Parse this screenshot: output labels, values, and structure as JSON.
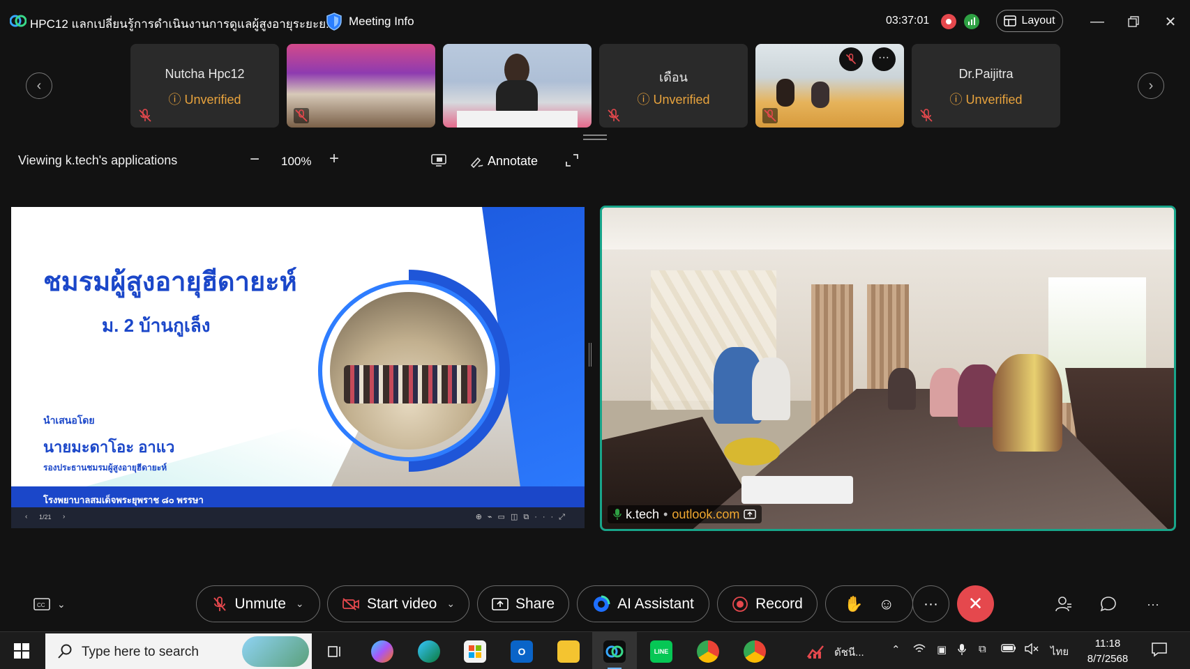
{
  "window": {
    "title": "HPC12 แลกเปลี่ยนรู้การดำเนินงานการดูแลผู้สูงอายุระยะย...",
    "meeting_info_label": "Meeting Info",
    "timer": "03:37:01",
    "layout_label": "Layout"
  },
  "participants": [
    {
      "name": "Nutcha Hpc12",
      "status": "Unverified",
      "video": false
    },
    {
      "name": "",
      "status": "",
      "video": true
    },
    {
      "name": "",
      "status": "",
      "video": true
    },
    {
      "name": "เดือน",
      "status": "Unverified",
      "video": false
    },
    {
      "name": "",
      "status": "",
      "video": true
    },
    {
      "name": "Dr.Paijitra",
      "status": "Unverified",
      "video": false
    }
  ],
  "share_toolbar": {
    "viewing_label": "Viewing k.tech's applications",
    "zoom": "100%",
    "annotate_label": "Annotate"
  },
  "slide": {
    "title": "ชมรมผู้สูงอายุฮีดายะห์",
    "subtitle": "ม. 2 บ้านกูเล็ง",
    "presented_by": "นำเสนอโดย",
    "presenter": "นายมะดาโอะ  อาแว",
    "presenter_role": "รองประธานชมรมผู้สูงอายุฮีดายะห์",
    "footer": "โรงพยาบาลสมเด็จพระยุพราช ๘๐ พรรษา",
    "page": "1/21"
  },
  "speaker": {
    "name": "k.tech",
    "domain": "outlook.com"
  },
  "controls": {
    "unmute": "Unmute",
    "start_video": "Start video",
    "share": "Share",
    "ai_assistant": "AI Assistant",
    "record": "Record",
    "more": "···",
    "end_icon": "close-icon"
  },
  "taskbar": {
    "search_placeholder": "Type here to search",
    "tray_app_label": "ดัชนี...",
    "input_lang": "ไทย",
    "time": "11:18",
    "date": "8/7/2568"
  },
  "colors": {
    "accent_teal": "#18a58a",
    "end_red": "#e5484d",
    "unverified": "#e8a33d",
    "slide_blue": "#1b47c9"
  }
}
